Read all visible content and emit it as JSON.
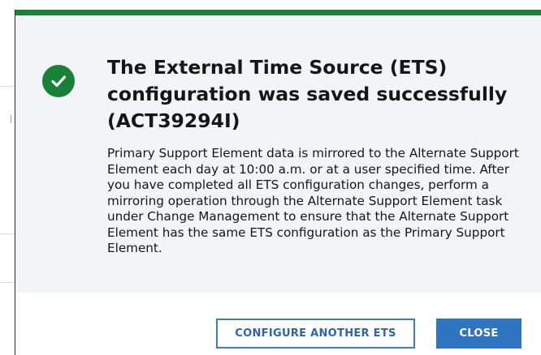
{
  "dialog": {
    "status_icon": "checkmark-icon",
    "title": "The External Time Source (ETS) configuration was saved successfully (ACT39294I)",
    "message": "Primary Support Element data is mirrored to the Alternate Support Element each day at 10:00 a.m. or at a user specified time. After you have completed all ETS configuration changes, perform a mirroring operation through the Alternate Support Element task under Change Management to ensure that the Alternate Support Element has the same ETS configuration as the Primary Support Element.",
    "buttons": {
      "configure_another_label": "CONFIGURE ANOTHER ETS",
      "close_label": "CLOSE"
    }
  },
  "colors": {
    "success": "#198038",
    "primary_button": "#2f74c0",
    "secondary_button_border": "#3e7dc4",
    "dialog_background": "#f2f4f8"
  }
}
